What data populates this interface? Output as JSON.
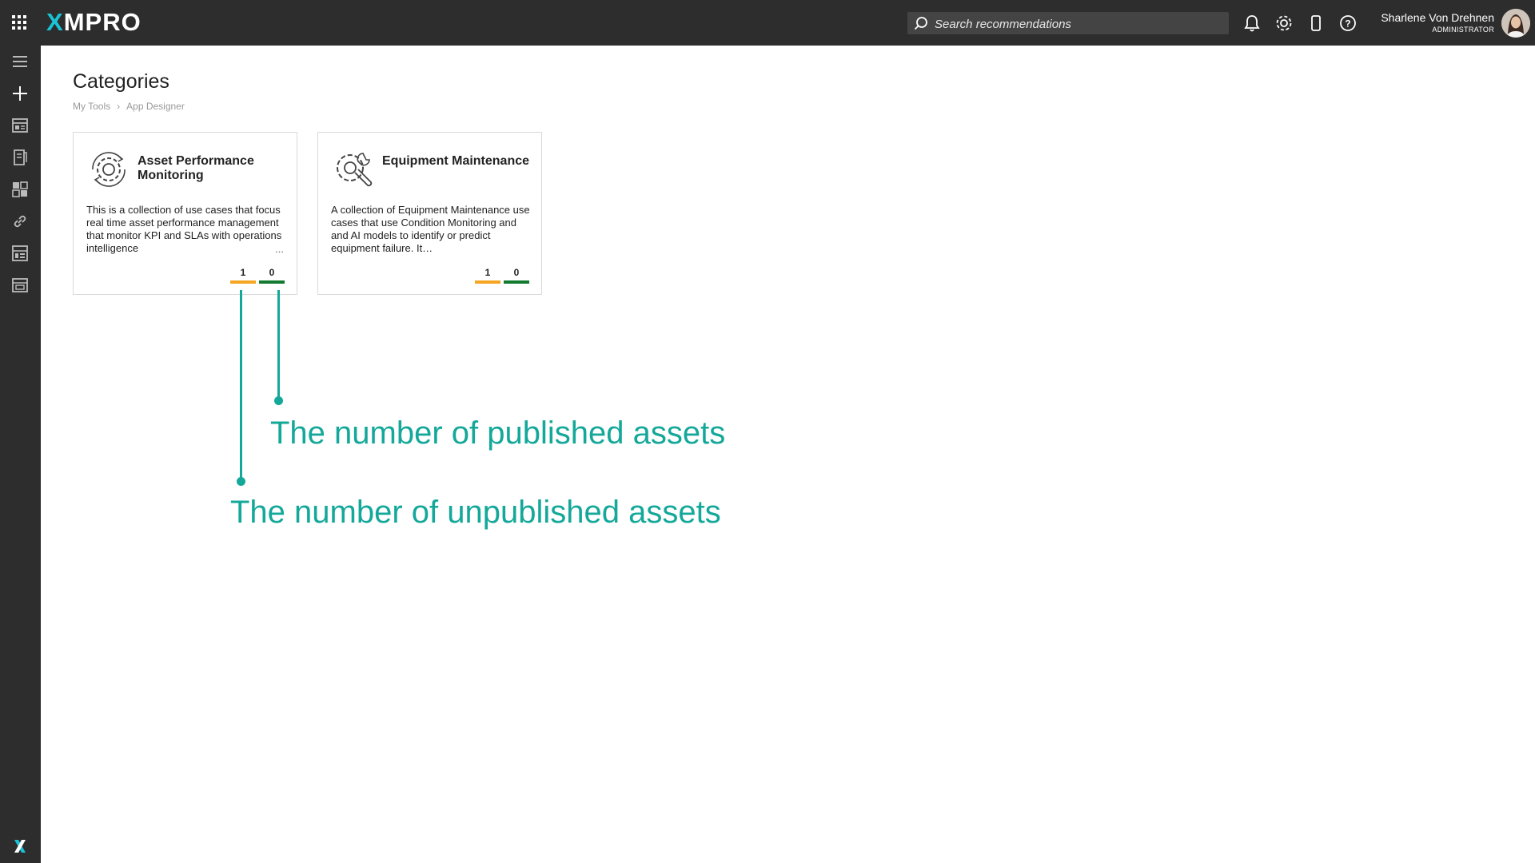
{
  "header": {
    "logo_text": "XMPRO",
    "search_placeholder": "Search recommendations",
    "user_name": "Sharlene Von Drehnen",
    "user_role": "ADMINISTRATOR",
    "icons": [
      "apps-grid-icon",
      "search-icon",
      "bell-icon",
      "gear-icon",
      "mobile-icon",
      "help-icon"
    ]
  },
  "sidebar": {
    "items": [
      "menu-icon",
      "add-icon",
      "app-list-icon",
      "recommendations-icon",
      "dashboard-icon",
      "link-icon",
      "data-stream-icon",
      "app-designer-icon"
    ],
    "footer_logo": "xmpro-x-icon"
  },
  "page": {
    "title": "Categories",
    "breadcrumb": [
      "My Tools",
      "App Designer"
    ]
  },
  "cards": [
    {
      "title": "Asset Performance Monitoring",
      "description": "This is a collection of use cases that focus real time asset performance management that monitor KPI and SLAs with operations intelligence",
      "has_more": "...",
      "unpublished": "1",
      "published": "0",
      "icon": "gear-cycle-icon"
    },
    {
      "title": "Equipment Maintenance",
      "description": "A collection of Equipment Maintenance use cases that use Condition Monitoring and and AI models to identify or predict equipment failure. It…",
      "unpublished": "1",
      "published": "0",
      "icon": "gear-wrench-icon"
    }
  ],
  "annotations": {
    "published": "The number of published assets",
    "unpublished": "The number of unpublished assets"
  },
  "colors": {
    "topbar": "#2d2d2d",
    "accent_cyan": "#19c3d6",
    "annotation": "#14a89a",
    "unpublished_bar": "#f5a623",
    "published_bar": "#117a2f"
  }
}
